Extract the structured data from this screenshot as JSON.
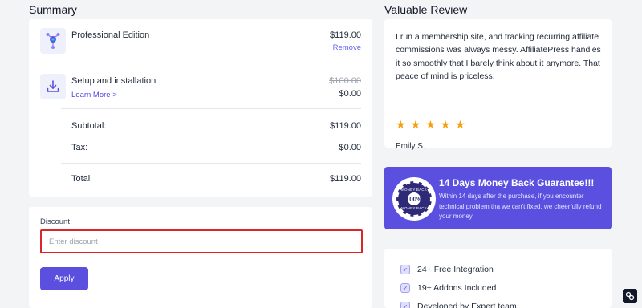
{
  "summary": {
    "title": "Summary",
    "items": [
      {
        "name": "Professional Edition",
        "price": "$119.00",
        "action": "Remove",
        "icon": "tree-node-icon"
      },
      {
        "name": "Setup and installation",
        "link": "Learn More >",
        "old_price": "$100.00",
        "price": "$0.00",
        "icon": "download-icon"
      }
    ],
    "subtotal_label": "Subtotal:",
    "subtotal_value": "$119.00",
    "tax_label": "Tax:",
    "tax_value": "$0.00",
    "total_label": "Total",
    "total_value": "$119.00"
  },
  "discount": {
    "label": "Discount",
    "placeholder": "Enter discount",
    "value": "",
    "apply_label": "Apply"
  },
  "review": {
    "title": "Valuable Review",
    "text": "I run a membership site, and tracking recurring affiliate commissions was always messy. AffiliatePress handles it so smoothly that I barely think about it anymore. That peace of mind is priceless.",
    "rating": 5,
    "reviewer": "Emily S."
  },
  "guarantee": {
    "title": "14 Days Money Back Guarantee!!!",
    "text": "Within 14 days after the purchase, if you encounter technical problem tha we can't fixed, we cheerfully refund your money.",
    "badge_top": "MONEY BACK",
    "badge_number": "100%",
    "badge_bottom": "MONEY BACK"
  },
  "features": [
    "24+ Free Integration",
    "19+ Addons Included",
    "Developed by Expert team"
  ],
  "colors": {
    "accent": "#5b4fe0",
    "star": "#f59e0b",
    "error_border": "#dc2626"
  }
}
